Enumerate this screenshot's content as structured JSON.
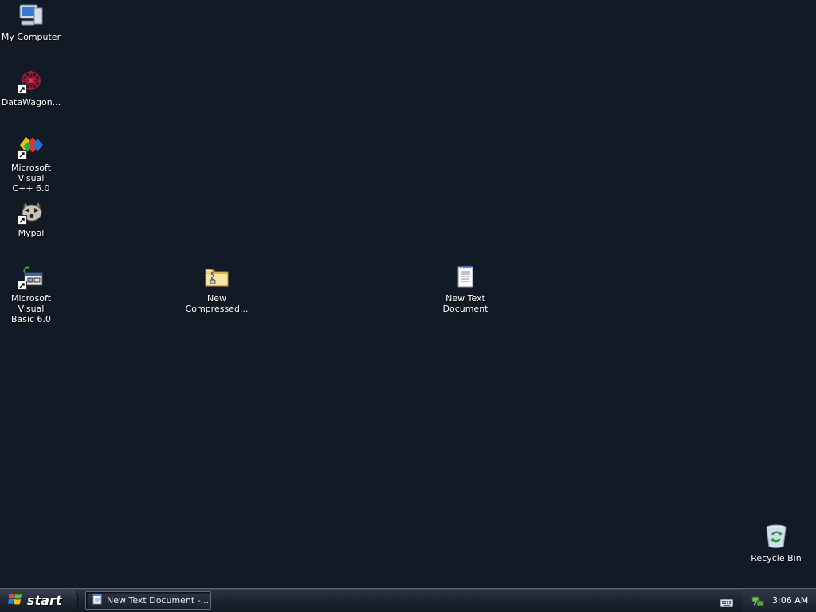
{
  "desktop": {
    "background_color": "#121a26",
    "icons": [
      {
        "label": "My Computer",
        "icon": "my-computer-icon"
      },
      {
        "label": "DataWagon...",
        "icon": "datawagon-icon"
      },
      {
        "label": "Microsoft Visual\nC++ 6.0",
        "icon": "visual-cpp-icon"
      },
      {
        "label": "Mypal",
        "icon": "mypal-icon"
      },
      {
        "label": "Microsoft Visual\nBasic 6.0",
        "icon": "visual-basic-icon"
      },
      {
        "label": "New\nCompressed...",
        "icon": "zip-folder-icon"
      },
      {
        "label": "New Text\nDocument",
        "icon": "text-document-icon"
      },
      {
        "label": "Recycle Bin",
        "icon": "recycle-bin-icon"
      }
    ]
  },
  "taskbar": {
    "start_label": "start",
    "task_button_label": "New Text Document -...",
    "task_button_icon": "notepad-icon",
    "keyboard_icon": "keyboard-icon",
    "tray_icon": "network-icon",
    "clock": "3:06 AM"
  }
}
